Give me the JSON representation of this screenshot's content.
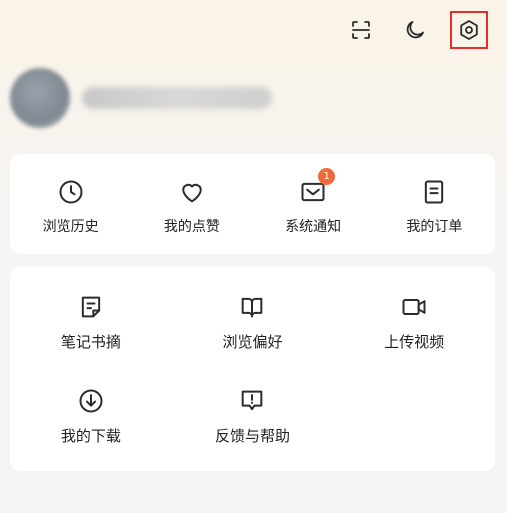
{
  "topbar": {
    "icons": [
      "scan-icon",
      "moon-icon",
      "settings-icon"
    ]
  },
  "quick_links": [
    {
      "label": "浏览历史",
      "icon": "clock-icon"
    },
    {
      "label": "我的点赞",
      "icon": "heart-icon"
    },
    {
      "label": "系统通知",
      "icon": "mail-icon",
      "badge": "1"
    },
    {
      "label": "我的订单",
      "icon": "document-icon"
    }
  ],
  "tools": [
    {
      "label": "笔记书摘",
      "icon": "note-icon"
    },
    {
      "label": "浏览偏好",
      "icon": "book-icon"
    },
    {
      "label": "上传视频",
      "icon": "video-camera-icon"
    },
    {
      "label": "我的下载",
      "icon": "download-icon"
    },
    {
      "label": "反馈与帮助",
      "icon": "feedback-icon"
    }
  ],
  "colors": {
    "badge": "#f06a3d",
    "highlight_outline": "#e3302a",
    "card_bg": "#ffffff"
  }
}
